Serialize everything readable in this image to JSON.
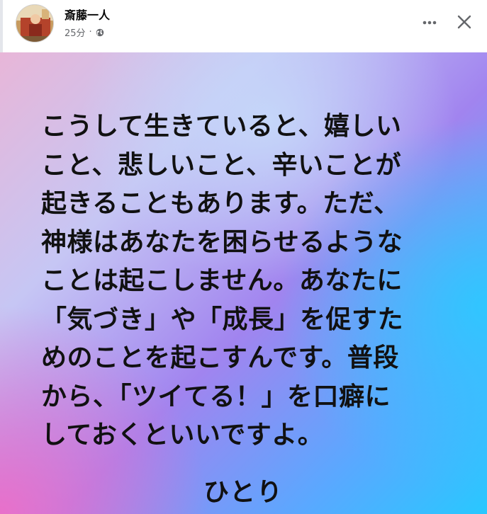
{
  "header": {
    "author_name": "斎藤一人",
    "timestamp": "25分",
    "separator": "·",
    "audience_icon": "globe-icon",
    "more_icon": "more-dots-icon",
    "close_icon": "close-icon"
  },
  "post": {
    "lines": [
      "こうして生きていると、嬉しい",
      "こと、悲しいこと、辛いことが",
      "起きることもあります。ただ、",
      "神様はあなたを困らせるような",
      "ことは起こしません。あなたに",
      "「気づき」や「成長」を促すた",
      "めのことを起こすんです。普段",
      "から、「ツイてる！」を口癖に",
      "しておくといいですよ。"
    ],
    "signature": "ひとり"
  },
  "colors": {
    "gradient_pink": "#e8b6d8",
    "gradient_violet": "#a184ef",
    "gradient_cyan": "#28c8ff",
    "text": "#111111",
    "meta_text": "#65676b"
  }
}
